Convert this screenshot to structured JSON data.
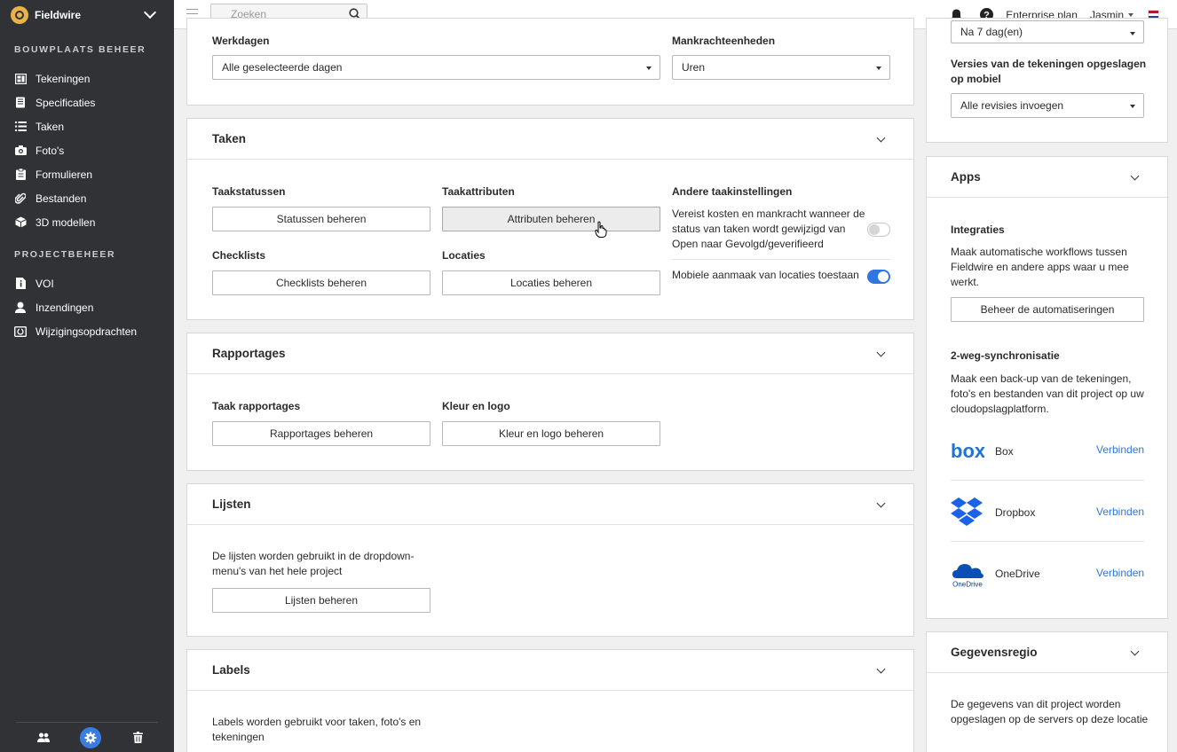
{
  "brand": {
    "name": "Fieldwire"
  },
  "sidebar": {
    "section1_title": "BOUWPLAATS BEHEER",
    "section1_items": [
      {
        "label": "Tekeningen",
        "icon": "plans-icon"
      },
      {
        "label": "Specificaties",
        "icon": "book-icon"
      },
      {
        "label": "Taken",
        "icon": "list-icon"
      },
      {
        "label": "Foto's",
        "icon": "camera-icon"
      },
      {
        "label": "Formulieren",
        "icon": "clipboard-icon"
      },
      {
        "label": "Bestanden",
        "icon": "paperclip-icon"
      },
      {
        "label": "3D modellen",
        "icon": "cube-icon"
      }
    ],
    "section2_title": "PROJECTBEHEER",
    "section2_items": [
      {
        "label": "VOI",
        "icon": "document-info-icon"
      },
      {
        "label": "Inzendingen",
        "icon": "person-icon"
      },
      {
        "label": "Wijzigingsopdrachten",
        "icon": "change-order-icon"
      }
    ]
  },
  "topbar": {
    "search_placeholder": "Zoeken",
    "plan": "Enterprise plan",
    "user": "Jasmin"
  },
  "general": {
    "workdays_label": "Werkdagen",
    "workdays_value": "Alle geselecteerde dagen",
    "manpower_label": "Mankrachteenheden",
    "manpower_value": "Uren"
  },
  "taken": {
    "title": "Taken",
    "statuses_label": "Taakstatussen",
    "statuses_button": "Statussen beheren",
    "attributes_label": "Taakattributen",
    "attributes_button": "Attributen beheren",
    "other_label": "Andere taakinstellingen",
    "cost_text": "Vereist kosten en mankracht wanneer de status van taken wordt gewijzigd van Open naar Gevolgd/geverifieerd",
    "cost_toggle": false,
    "mobile_text": "Mobiele aanmaak van locaties toestaan",
    "mobile_toggle": true,
    "checklists_label": "Checklists",
    "checklists_button": "Checklists beheren",
    "locations_label": "Locaties",
    "locations_button": "Locaties beheren"
  },
  "rapportages": {
    "title": "Rapportages",
    "task_reports_label": "Taak rapportages",
    "task_reports_button": "Rapportages beheren",
    "color_logo_label": "Kleur en logo",
    "color_logo_button": "Kleur en logo beheren"
  },
  "lijsten": {
    "title": "Lijsten",
    "description": "De lijsten worden gebruikt in de dropdown-menu's van het hele project",
    "button": "Lijsten beheren"
  },
  "labels": {
    "title": "Labels",
    "description": "Labels worden gebruikt voor taken, foto's en tekeningen"
  },
  "right_top": {
    "select_value": "Na 7 dag(en)",
    "versions_label": "Versies van de tekeningen opgeslagen op mobiel",
    "versions_value": "Alle revisies invoegen"
  },
  "apps": {
    "title": "Apps",
    "integrations_label": "Integraties",
    "integrations_text": "Maak automatische workflows tussen Fieldwire en andere apps waar u mee werkt.",
    "integrations_button": "Beheer de automatiseringen",
    "sync_label": "2-weg-synchronisatie",
    "sync_text": "Maak een back-up van de tekeningen, foto's en bestanden van dit project op uw cloudopslagplatform.",
    "providers": [
      {
        "name": "Box",
        "action": "Verbinden",
        "logo_text": "box"
      },
      {
        "name": "Dropbox",
        "action": "Verbinden"
      },
      {
        "name": "OneDrive",
        "action": "Verbinden",
        "logo_text": "OneDrive"
      }
    ]
  },
  "region": {
    "title": "Gegevensregio",
    "text": "De gegevens van dit project worden opgeslagen op de servers op deze locatie"
  },
  "colors": {
    "sidebar": "#303236",
    "accent": "#2f76e0",
    "brand": "#e9b34a"
  }
}
